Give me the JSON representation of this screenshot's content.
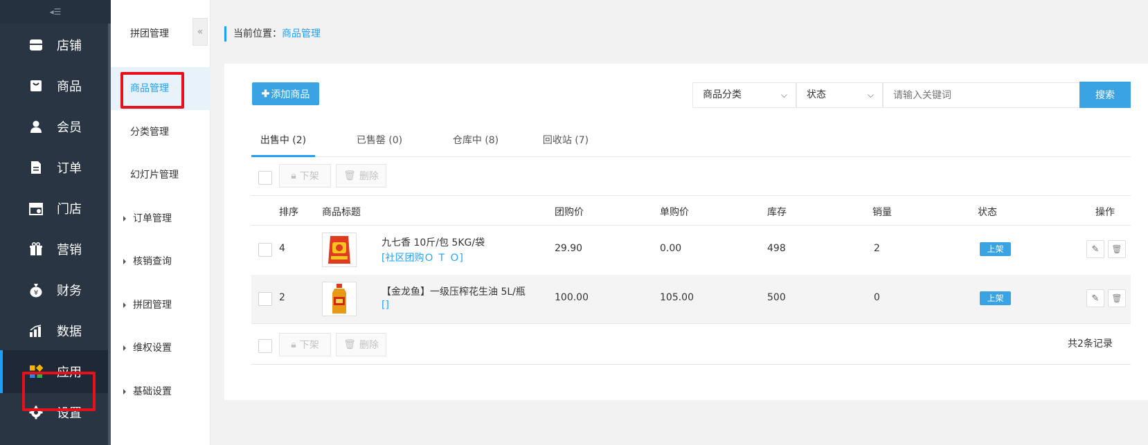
{
  "sidebar": {
    "toggle_icon": "menu-collapse-icon",
    "items": [
      {
        "label": "店铺",
        "icon": "store-icon"
      },
      {
        "label": "商品",
        "icon": "bag-icon"
      },
      {
        "label": "会员",
        "icon": "user-icon"
      },
      {
        "label": "订单",
        "icon": "document-icon"
      },
      {
        "label": "门店",
        "icon": "shop-front-icon"
      },
      {
        "label": "营销",
        "icon": "gift-icon"
      },
      {
        "label": "财务",
        "icon": "money-bag-icon"
      },
      {
        "label": "数据",
        "icon": "bar-chart-icon"
      },
      {
        "label": "应用",
        "icon": "apps-grid-icon"
      },
      {
        "label": "设置",
        "icon": "gear-icon"
      }
    ],
    "active_index": 8
  },
  "submenu": {
    "items": [
      {
        "label": "拼团管理"
      },
      {
        "label": "商品管理"
      },
      {
        "label": "分类管理"
      },
      {
        "label": "幻灯片管理"
      },
      {
        "label": "订单管理"
      },
      {
        "label": "核销查询"
      },
      {
        "label": "拼团管理"
      },
      {
        "label": "维权设置"
      },
      {
        "label": "基础设置"
      }
    ],
    "collapse_glyph": "«"
  },
  "breadcrumb": {
    "prefix": "当前位置：",
    "current": "商品管理"
  },
  "toolbar": {
    "add_label": "添加商品",
    "category_select": "商品分类",
    "status_select": "状态",
    "search_placeholder": "请输入关键词",
    "search_label": "搜索"
  },
  "tabs": [
    {
      "label": "出售中 (2)"
    },
    {
      "label": "已售罄 (0)"
    },
    {
      "label": "仓库中 (8)"
    },
    {
      "label": "回收站 (7)"
    }
  ],
  "bulk": {
    "offshelf_label": "下架",
    "delete_label": "删除"
  },
  "table": {
    "headers": [
      "排序",
      "商品标题",
      "团购价",
      "单购价",
      "库存",
      "销量",
      "状态",
      "操作"
    ],
    "rows": [
      {
        "sort": "4",
        "title": "九七香 10斤/包 5KG/袋",
        "tag": "[社区团购Ｏ Ｔ Ｏ]",
        "group_price": "29.90",
        "single_price": "0.00",
        "stock": "498",
        "sales": "2",
        "status": "上架"
      },
      {
        "sort": "2",
        "title": "【金龙鱼】一级压榨花生油 5L/瓶",
        "tag": "[]",
        "group_price": "100.00",
        "single_price": "105.00",
        "stock": "500",
        "sales": "0",
        "status": "上架"
      }
    ]
  },
  "footer": {
    "total": "共2条记录"
  },
  "colors": {
    "accent": "#1e9fff",
    "button": "#3aa3e3",
    "sidebar_bg": "#2a3544",
    "highlight": "#e8101a"
  }
}
